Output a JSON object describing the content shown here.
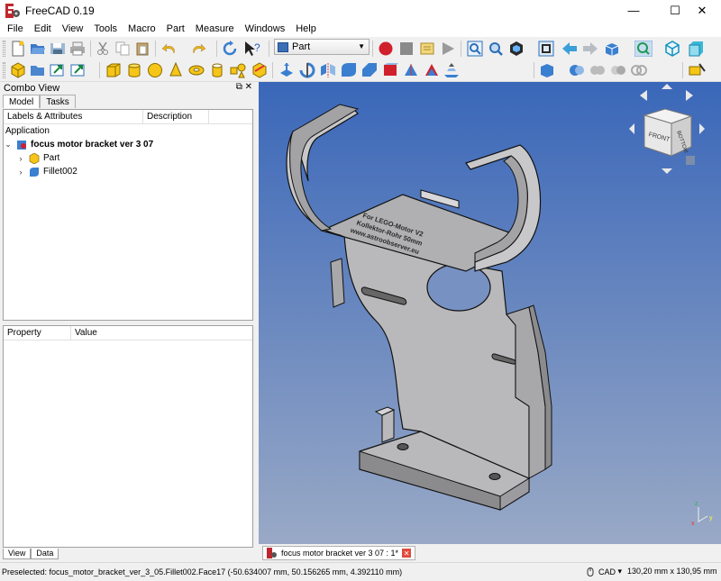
{
  "window": {
    "title": "FreeCAD 0.19",
    "minimize": "—",
    "maximize": "☐",
    "close": "✕"
  },
  "menu": [
    "File",
    "Edit",
    "View",
    "Tools",
    "Macro",
    "Part",
    "Measure",
    "Windows",
    "Help"
  ],
  "workbench": {
    "selected": "Part"
  },
  "combo_view": {
    "title": "Combo View",
    "tabs": [
      "Model",
      "Tasks"
    ],
    "tree_headers": [
      "Labels & Attributes",
      "Description"
    ],
    "application_label": "Application",
    "document": "focus motor bracket ver 3 07",
    "items": [
      "Part",
      "Fillet002"
    ],
    "property_headers": [
      "Property",
      "Value"
    ],
    "bottom_tabs": [
      "View",
      "Data"
    ]
  },
  "viewer": {
    "tab_label": "focus motor bracket ver 3 07 : 1*",
    "cube_faces": {
      "front": "FRONT",
      "right": "RIGHT",
      "bottom": "BOTTOM"
    },
    "model_engraving": [
      "For LEGO-Motor V2",
      "Kollektor-Rohr 50mm",
      "www.astroobserver.eu"
    ]
  },
  "status_bar": {
    "preselected": "Preselected: focus_motor_bracket_ver_3_05.Fillet002.Face17 (-50.634007 mm, 50.156265 mm, 4.392110 mm)",
    "nav_style": "CAD",
    "dimensions": "130,20 mm x 130,95 mm"
  },
  "colors": {
    "viewer_top": "#3a67b9",
    "viewer_bottom": "#99a9c6",
    "model": "#b9b9bb",
    "model_shadow": "#8b8b8e"
  },
  "icons": [
    "new-icon",
    "open-icon",
    "save-icon",
    "print-icon",
    "cut-icon",
    "copy-icon",
    "paste-icon",
    "undo-icon",
    "redo-icon",
    "refresh-icon",
    "whats-this-icon",
    "record-macro-icon",
    "stop-macro-icon",
    "edit-macro-icon",
    "run-macro-icon",
    "fit-all-icon",
    "fit-selection-icon",
    "draw-style-icon",
    "bounding-box-icon",
    "nav-back-icon",
    "nav-forward-icon",
    "std-views-icon",
    "zoom-icon",
    "isometric-icon",
    "front-view-icon"
  ]
}
